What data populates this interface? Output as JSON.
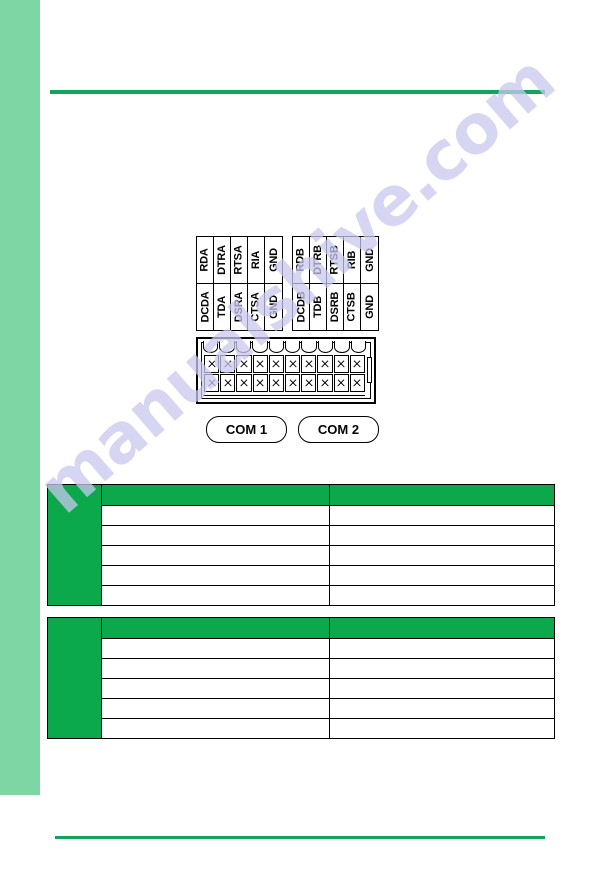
{
  "page": {
    "accent_green": "#0ba84c",
    "sidebar_green": "#7ed6a4",
    "rule_green": "#0ea55c",
    "watermark_text": "manualshive.com"
  },
  "figure": {
    "com1": {
      "pill_label": "COM 1",
      "columns": [
        {
          "upper": "RDA",
          "lower": "DCDA"
        },
        {
          "upper": "DTRA",
          "lower": "TDA"
        },
        {
          "upper": "RTSA",
          "lower": "DSRA"
        },
        {
          "upper": "RIA",
          "lower": "CTSA"
        },
        {
          "upper": "GND",
          "lower": "GND"
        }
      ]
    },
    "com2": {
      "pill_label": "COM 2",
      "columns": [
        {
          "upper": "RDB",
          "lower": "DCDB"
        },
        {
          "upper": "DTRB",
          "lower": "TDB"
        },
        {
          "upper": "RTSB",
          "lower": "DSRB"
        },
        {
          "upper": "RIB",
          "lower": "CTSB"
        },
        {
          "upper": "GND",
          "lower": "GND"
        }
      ]
    }
  },
  "tables": [
    {
      "side_label": "",
      "headers": {
        "signal": "",
        "description": ""
      },
      "rows": [
        {
          "signal": "",
          "description": ""
        },
        {
          "signal": "",
          "description": ""
        },
        {
          "signal": "",
          "description": ""
        },
        {
          "signal": "",
          "description": ""
        },
        {
          "signal": "",
          "description": ""
        }
      ]
    },
    {
      "side_label": "",
      "headers": {
        "signal": "",
        "description": ""
      },
      "rows": [
        {
          "signal": "",
          "description": ""
        },
        {
          "signal": "",
          "description": ""
        },
        {
          "signal": "",
          "description": ""
        },
        {
          "signal": "",
          "description": ""
        },
        {
          "signal": "",
          "description": ""
        }
      ]
    }
  ]
}
